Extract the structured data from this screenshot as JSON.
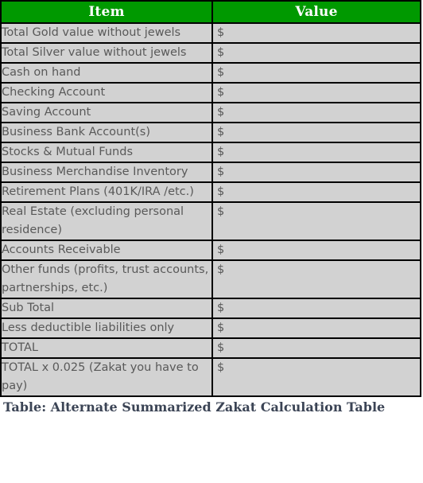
{
  "table": {
    "headers": {
      "item": "Item",
      "value": "Value"
    },
    "rows": [
      {
        "item": "Total Gold value without jewels",
        "value": "$"
      },
      {
        "item": "Total Silver value without jewels",
        "value": "$"
      },
      {
        "item": "Cash on hand",
        "value": "$"
      },
      {
        "item": "Checking Account",
        "value": "$"
      },
      {
        "item": "Saving Account",
        "value": "$"
      },
      {
        "item": "Business Bank Account(s)",
        "value": "$"
      },
      {
        "item": "Stocks & Mutual Funds",
        "value": "$"
      },
      {
        "item": "Business Merchandise Inventory",
        "value": "$"
      },
      {
        "item": "Retirement Plans (401K/IRA /etc.)",
        "value": "$"
      },
      {
        "item": "Real Estate (excluding personal residence)",
        "value": "$"
      },
      {
        "item": "Accounts Receivable",
        "value": "$"
      },
      {
        "item": "Other funds (profits, trust accounts, partnerships, etc.)",
        "value": "$"
      },
      {
        "item": "Sub Total",
        "value": "$"
      },
      {
        "item": "Less deductible liabilities only",
        "value": "$"
      },
      {
        "item": "TOTAL",
        "value": "$"
      },
      {
        "item": "TOTAL x 0.025 (Zakat you have to pay)",
        "value": "$"
      }
    ]
  },
  "caption": "Table: Alternate Summarized Zakat Calculation Table",
  "colors": {
    "header_background": "#009900",
    "header_text": "#ffffff",
    "cell_background": "#d2d2d2",
    "cell_text": "#595959",
    "border": "#000000",
    "caption_text": "#3b4455",
    "page_background": "#ffffff"
  }
}
